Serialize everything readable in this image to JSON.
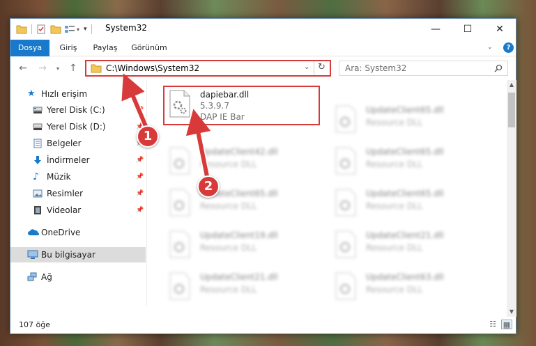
{
  "window": {
    "title": "System32",
    "controls": {
      "minimize": "—",
      "maximize": "☐",
      "close": "✕"
    }
  },
  "ribbon": {
    "tabs": [
      "Dosya",
      "Giriş",
      "Paylaş",
      "Görünüm"
    ]
  },
  "address": {
    "path": "C:\\Windows\\System32",
    "search_placeholder": "Ara: System32"
  },
  "sidebar": {
    "items": [
      {
        "label": "Hızlı erişim",
        "icon": "star-icon"
      },
      {
        "label": "Yerel Disk (C:)",
        "icon": "drive-icon"
      },
      {
        "label": "Yerel Disk (D:)",
        "icon": "drive-icon"
      },
      {
        "label": "Belgeler",
        "icon": "documents-icon"
      },
      {
        "label": "İndirmeler",
        "icon": "download-icon"
      },
      {
        "label": "Müzik",
        "icon": "music-icon"
      },
      {
        "label": "Resimler",
        "icon": "pictures-icon"
      },
      {
        "label": "Videolar",
        "icon": "videos-icon"
      },
      {
        "label": "OneDrive",
        "icon": "onedrive-icon"
      },
      {
        "label": "Bu bilgisayar",
        "icon": "computer-icon"
      },
      {
        "label": "Ağ",
        "icon": "network-icon"
      }
    ]
  },
  "files": {
    "highlighted": {
      "name": "dapiebar.dll",
      "version": "5.3.9.7",
      "description": "DAP IE Bar"
    },
    "left_column": [
      {
        "name": "UpdateClient42.dll",
        "type": "Resource DLL"
      },
      {
        "name": "UpdateClient65.dll",
        "type": "Resource DLL"
      },
      {
        "name": "UpdateClient19.dll",
        "type": "Resource DLL"
      },
      {
        "name": "UpdateClient21.dll",
        "type": "Resource DLL"
      }
    ],
    "right_column": [
      {
        "name": "UpdateClient65.dll",
        "type": "Resource DLL"
      },
      {
        "name": "UpdateClient65.dll",
        "type": "Resource DLL"
      },
      {
        "name": "UpdateClient65.dll",
        "type": "Resource DLL"
      },
      {
        "name": "UpdateClient21.dll",
        "type": "Resource DLL"
      },
      {
        "name": "UpdateClient63.dll",
        "type": "Resource DLL"
      }
    ]
  },
  "status": {
    "count": "107 öğe"
  },
  "annotations": {
    "step1": "1",
    "step2": "2"
  },
  "colors": {
    "accent": "#1979ca",
    "highlight": "#d83a3a"
  }
}
